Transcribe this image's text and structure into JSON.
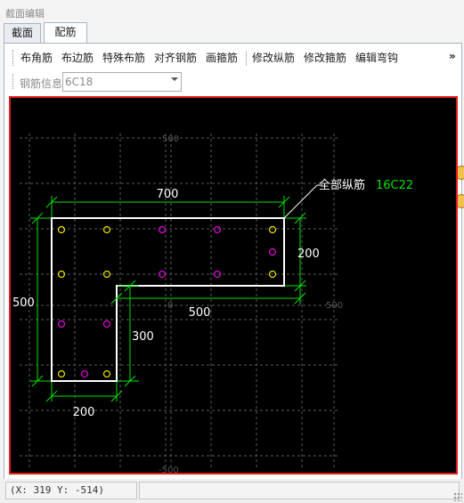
{
  "window": {
    "title": "截面编辑"
  },
  "tabs": [
    {
      "label": "截面",
      "active": false
    },
    {
      "label": "配筋",
      "active": true
    }
  ],
  "toolbar": {
    "items": [
      {
        "label": "布角筋"
      },
      {
        "label": "布边筋"
      },
      {
        "label": "特殊布筋"
      },
      {
        "label": "对齐钢筋"
      },
      {
        "label": "画箍筋"
      },
      {
        "label": "修改纵筋"
      },
      {
        "label": "修改箍筋"
      },
      {
        "label": "编辑弯钩"
      }
    ],
    "overflow": "»"
  },
  "rebar_info": {
    "label": "钢筋信息",
    "value": "6C18"
  },
  "drawing": {
    "grid_labels": {
      "top": "500",
      "right": "500",
      "center": "0",
      "bottom": "-500"
    },
    "dimensions": {
      "top": "700",
      "right": "200",
      "left": "500",
      "middle": "500",
      "inner": "300",
      "bottom": "200"
    },
    "annotation": {
      "label": "全部纵筋",
      "value": "16C22"
    },
    "colors": {
      "outline": "#ffffff",
      "dimension": "#00e000",
      "corner_bar": "#f2e200",
      "edge_bar": "#e000e0",
      "grid": "#5a5a5a",
      "border": "#e51a1a"
    }
  },
  "status": {
    "coords": "(X: 319 Y: -514)"
  }
}
